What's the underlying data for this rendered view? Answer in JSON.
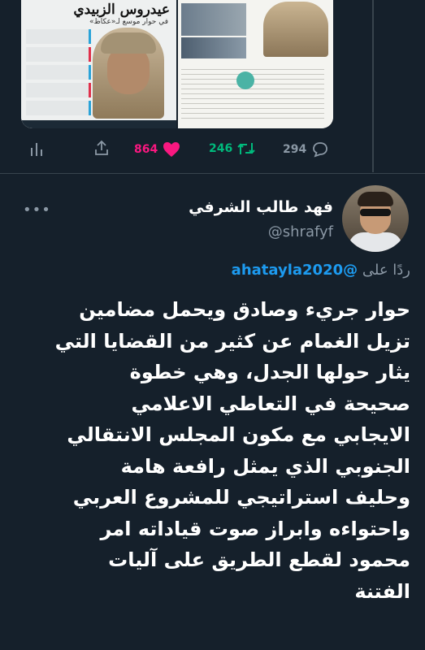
{
  "quoted_tweet": {
    "media": {
      "left_headline": "عيدروس الزبيدي",
      "left_subhead": "في حوار موسع لـ«عكاظ»"
    },
    "actions": {
      "replies": "294",
      "retweets": "246",
      "likes": "864"
    },
    "colors": {
      "retweet": "#00ba7c",
      "like": "#f91880",
      "muted": "#8b98a5"
    }
  },
  "reply": {
    "author": {
      "display_name": "فهد طالب الشرفي",
      "handle": "@shrafyf"
    },
    "replying_to_prefix": "ردًا على",
    "replying_to_handle": "@ahatayla2020",
    "text_lines": [
      "حوار جريء وصادق ويحمل مضامين",
      "تزيل الغمام عن كثير من القضايا التي",
      "يثار حولها الجدل، وهي خطوة",
      "صحيحة في التعاطي الاعلامي",
      "الايجابي مع مكون المجلس الانتقالي",
      "الجنوبي الذي يمثل رافعة هامة",
      "وحليف استراتيجي للمشروع العربي",
      "واحتواءه وابراز صوت قياداته امر",
      "محمود لقطع الطريق على آليات",
      "الفتنة"
    ]
  }
}
